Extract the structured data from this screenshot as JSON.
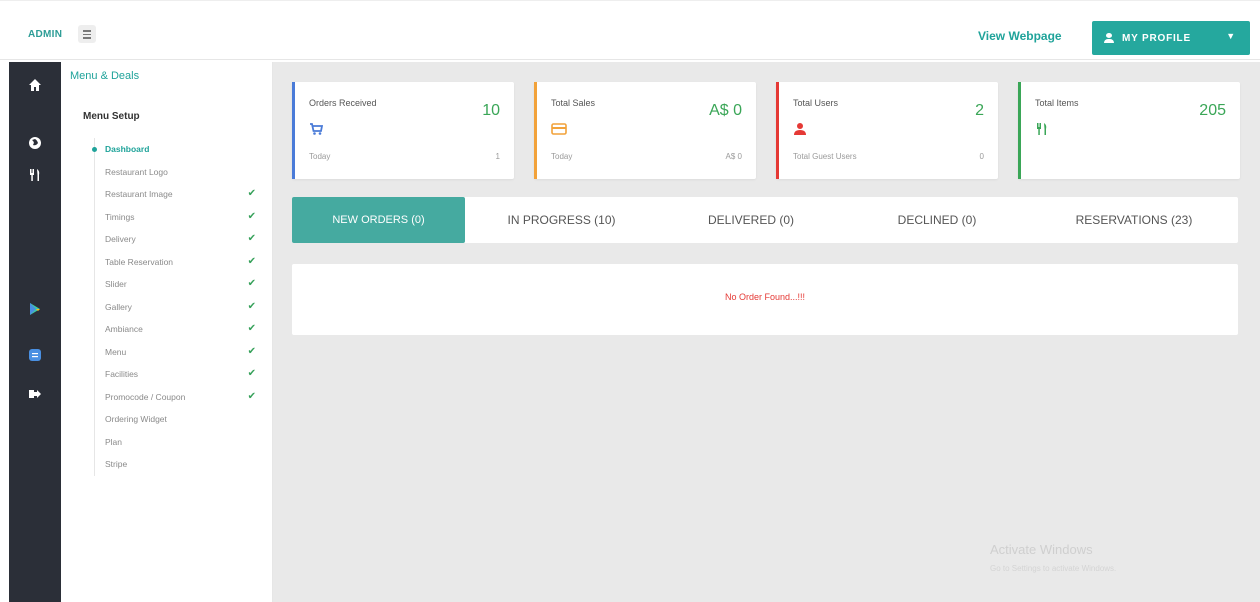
{
  "topbar": {
    "admin_label": "ADMIN",
    "view_webpage": "View Webpage",
    "profile_button": "MY PROFILE"
  },
  "darkbar": {
    "icons": [
      "home-icon",
      "globe-icon",
      "utensils-icon",
      "play-store-icon",
      "app-store-icon",
      "logout-icon"
    ]
  },
  "submenu": {
    "title": "Menu & Deals",
    "heading": "Menu Setup",
    "items": [
      {
        "label": "Dashboard",
        "checked": false
      },
      {
        "label": "Restaurant Logo",
        "checked": false
      },
      {
        "label": "Restaurant Image",
        "checked": true
      },
      {
        "label": "Timings",
        "checked": true
      },
      {
        "label": "Delivery",
        "checked": true
      },
      {
        "label": "Table Reservation",
        "checked": true
      },
      {
        "label": "Slider",
        "checked": true
      },
      {
        "label": "Gallery",
        "checked": true
      },
      {
        "label": "Ambiance",
        "checked": true
      },
      {
        "label": "Menu",
        "checked": true
      },
      {
        "label": "Facilities",
        "checked": true
      },
      {
        "label": "Promocode / Coupon",
        "checked": true
      },
      {
        "label": "Ordering Widget",
        "checked": false
      },
      {
        "label": "Plan",
        "checked": false
      },
      {
        "label": "Stripe",
        "checked": false
      }
    ]
  },
  "cards": [
    {
      "label": "Orders Received",
      "value": "10",
      "sub_label": "Today",
      "sub_value": "1",
      "color": "#4a7bd8",
      "icon": "cart-icon"
    },
    {
      "label": "Total Sales",
      "value": "A$ 0",
      "sub_label": "Today",
      "sub_value": "A$ 0",
      "color": "#f2a23a",
      "icon": "credit-card-icon"
    },
    {
      "label": "Total Users",
      "value": "2",
      "sub_label": "Total Guest Users",
      "sub_value": "0",
      "color": "#e53935",
      "icon": "user-icon"
    },
    {
      "label": "Total Items",
      "value": "205",
      "sub_label": "",
      "sub_value": "",
      "color": "#3aa657",
      "icon": "utensils-icon"
    }
  ],
  "tabs": [
    {
      "label": "NEW ORDERS (0)"
    },
    {
      "label": "IN PROGRESS (10)"
    },
    {
      "label": "DELIVERED (0)"
    },
    {
      "label": "DECLINED (0)"
    },
    {
      "label": "RESERVATIONS (23)"
    }
  ],
  "orders": {
    "empty_message": "No Order Found...!!!"
  },
  "watermark": {
    "title": "Activate Windows",
    "subtitle": "Go to Settings to activate Windows."
  }
}
